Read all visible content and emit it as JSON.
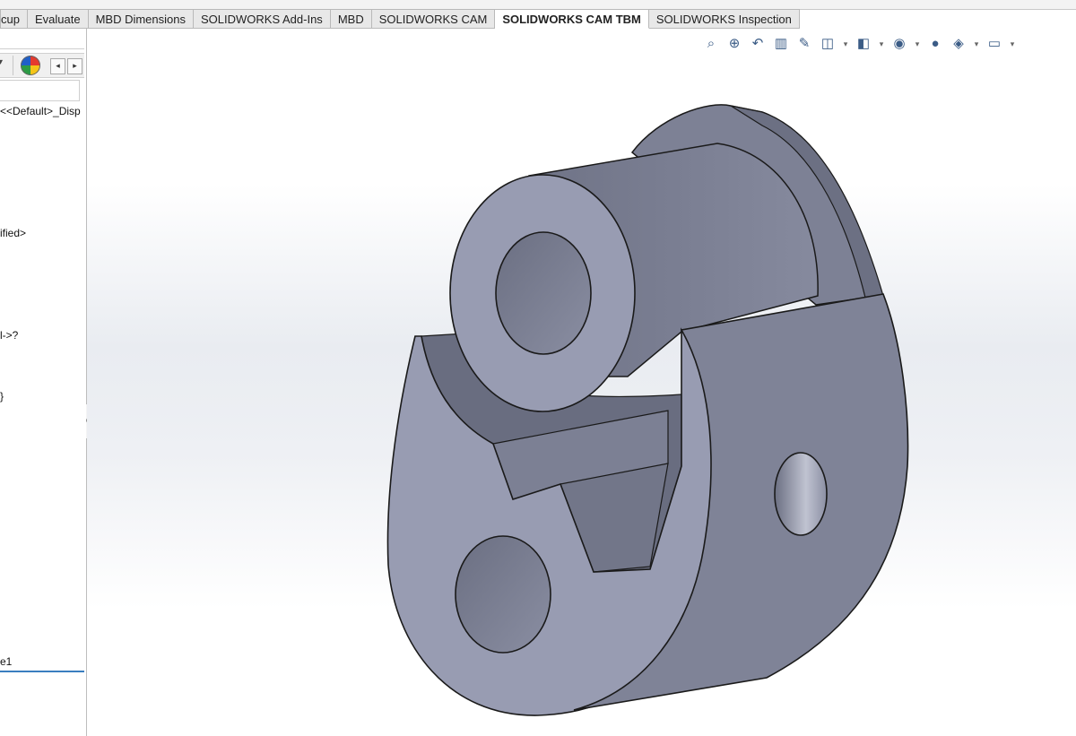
{
  "tabs": [
    {
      "label": "cup",
      "active": false
    },
    {
      "label": "Evaluate",
      "active": false
    },
    {
      "label": "MBD Dimensions",
      "active": false
    },
    {
      "label": "SOLIDWORKS Add-Ins",
      "active": false
    },
    {
      "label": "MBD",
      "active": false
    },
    {
      "label": "SOLIDWORKS CAM",
      "active": false
    },
    {
      "label": "SOLIDWORKS CAM TBM",
      "active": true
    },
    {
      "label": "SOLIDWORKS Inspection",
      "active": false
    }
  ],
  "feature_tree": {
    "items": [
      {
        "text": "<<Default>_Disp"
      },
      {
        "text": "ified>"
      },
      {
        "text": "l->?"
      },
      {
        "text": "}"
      },
      {
        "text": "e1"
      }
    ]
  },
  "panel_controls": {
    "dropdown_glyph": "▾",
    "prev_glyph": "◂",
    "next_glyph": "▸"
  },
  "view_toolbar": {
    "icons": [
      "zoom-to-fit-icon",
      "zoom-to-area-icon",
      "previous-view-icon",
      "section-view-icon",
      "dynamic-annotation-icon",
      "view-orientation-icon",
      "display-style-icon",
      "hide-show-items-icon",
      "edit-appearance-icon",
      "apply-scene-icon",
      "view-settings-icon"
    ]
  },
  "colors": {
    "model_face_light": "#989cb2",
    "model_face_mid": "#7f8397",
    "model_face_dark": "#6e7285",
    "edge": "#1a1a1a",
    "active_tab_bg": "#ffffff",
    "tab_bg": "#e8e8e8"
  }
}
